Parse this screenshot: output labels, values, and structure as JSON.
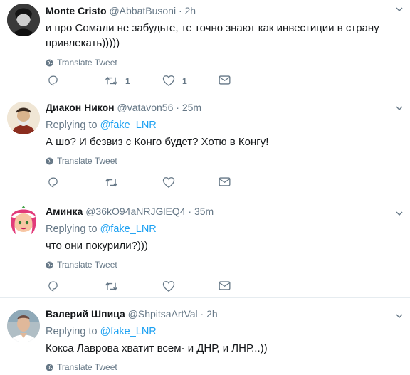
{
  "tweets": [
    {
      "name": "Monte Cristo",
      "handle": "@AbbatBusoni",
      "dot": "·",
      "time": "2h",
      "text": "и про Сомали не забудьте, те точно знают как инвестиции в страну привлекать)))))",
      "translate": "Translate Tweet",
      "retweets": "1",
      "likes": "1"
    },
    {
      "name": "Диакон Никон",
      "handle": "@vatavon56",
      "dot": "·",
      "time": "25m",
      "replying_prefix": "Replying to",
      "replying_to": "@fake_LNR",
      "text": "А шо? И безвиз с Конго будет? Хотю в Конгу!",
      "translate": "Translate Tweet"
    },
    {
      "name": "Аминка",
      "handle": "@36kO94aNRJGlEQ4",
      "dot": "·",
      "time": "35m",
      "replying_prefix": "Replying to",
      "replying_to": "@fake_LNR",
      "text": "что они покурили?)))",
      "translate": "Translate Tweet"
    },
    {
      "name": "Валерий Шпица",
      "handle": "@ShpitsaArtVal",
      "dot": "·",
      "time": "2h",
      "replying_prefix": "Replying to",
      "replying_to": "@fake_LNR",
      "text": "Кокса Лаврова хватит всем- и ДНР, и ЛНР...))",
      "translate": "Translate Tweet"
    }
  ],
  "icons": {
    "reply": "reply-icon",
    "retweet": "retweet-icon",
    "like": "heart-icon",
    "message": "envelope-icon",
    "globe": "globe-icon",
    "caret": "chevron-down-icon"
  },
  "colors": {
    "link": "#1da1f2",
    "muted": "#657786",
    "text": "#14171a",
    "divider": "#e6ecf0"
  }
}
